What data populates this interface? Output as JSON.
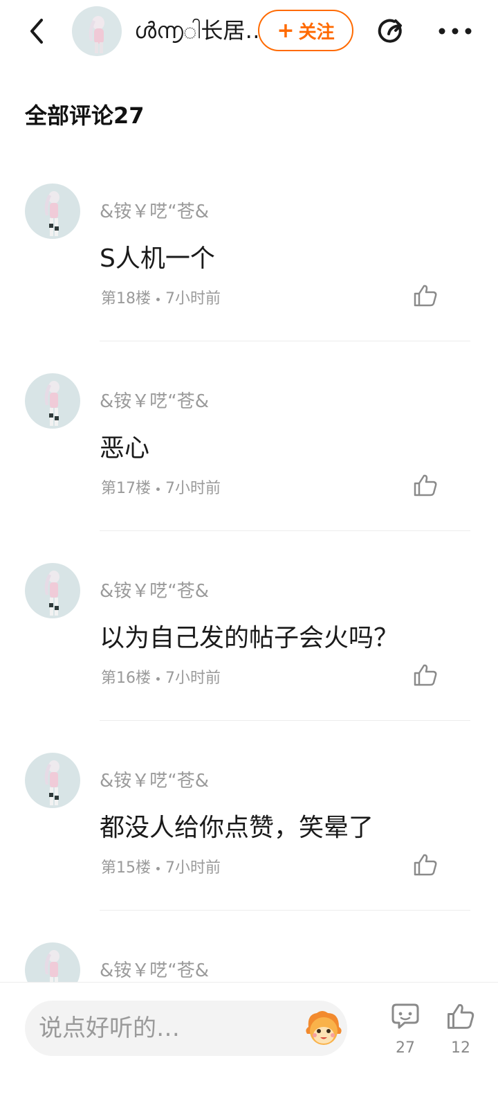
{
  "header": {
    "title": "ൾ൬ါ长居…",
    "follow_label": "关注",
    "follow_plus": "+",
    "icons": {
      "back": "chevron-left-icon",
      "share": "share-icon",
      "more": "more-dots-icon"
    },
    "accent_color": "#ff6a00"
  },
  "section": {
    "title": "全部评论27"
  },
  "comments": [
    {
      "username": "&铵￥呓“苍&",
      "content": "S人机一个",
      "floor": "第18楼",
      "time": "7小时前"
    },
    {
      "username": "&铵￥呓“苍&",
      "content": "恶心",
      "floor": "第17楼",
      "time": "7小时前"
    },
    {
      "username": "&铵￥呓“苍&",
      "content": "以为自己发的帖子会火吗？",
      "floor": "第16楼",
      "time": "7小时前"
    },
    {
      "username": "&铵￥呓“苍&",
      "content": "都没人给你点赞，笑晕了",
      "floor": "第15楼",
      "time": "7小时前"
    },
    {
      "username": "&铵￥呓“苍&",
      "content": "",
      "floor": "",
      "time": ""
    }
  ],
  "bottom_bar": {
    "input_placeholder": "说点好听的…",
    "comment_count": "27",
    "like_count": "12",
    "icons": {
      "emoji": "emoji-face-icon",
      "comment": "comment-bubble-icon",
      "like": "thumbs-up-icon"
    }
  }
}
